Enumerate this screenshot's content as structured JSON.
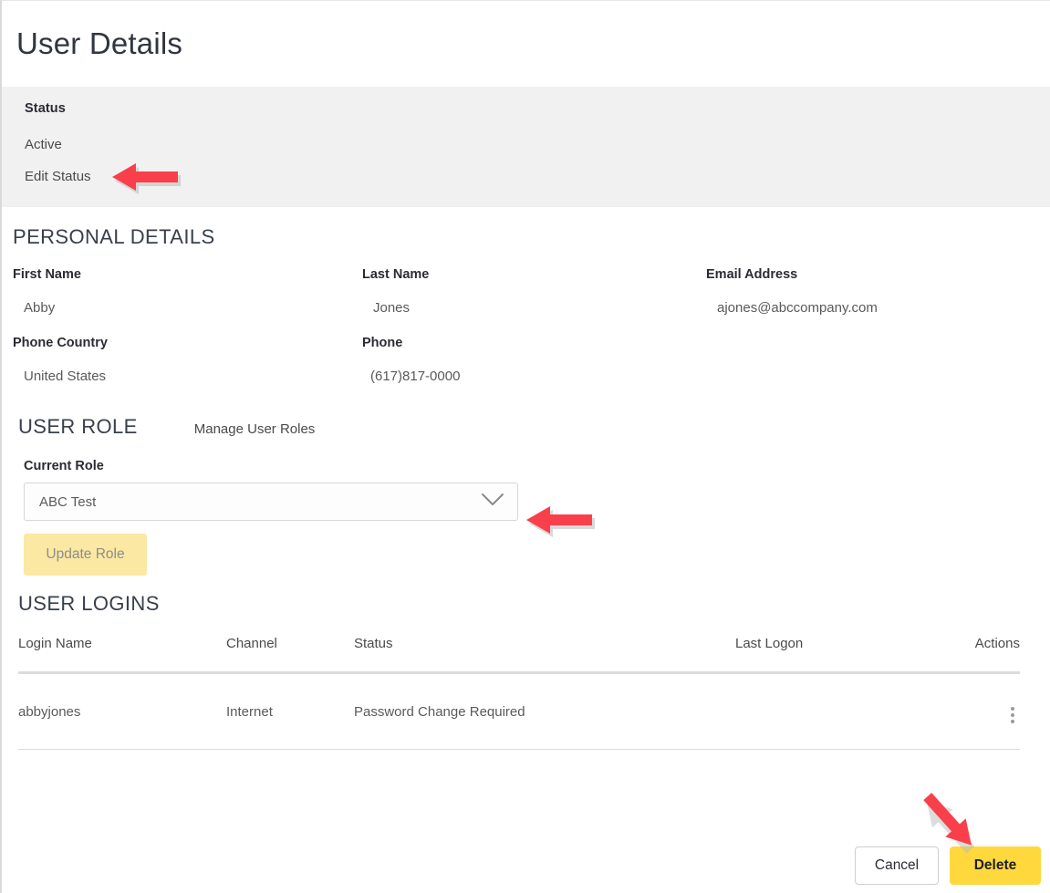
{
  "header": {
    "title": "User Details"
  },
  "status_section": {
    "label": "Status",
    "value": "Active",
    "edit_link": "Edit Status"
  },
  "personal_details": {
    "heading": "PERSONAL DETAILS",
    "fields": [
      {
        "label": "First Name",
        "value": "Abby"
      },
      {
        "label": "Last Name",
        "value": "Jones"
      },
      {
        "label": "Email Address",
        "value": "ajones@abccompany.com"
      },
      {
        "label": "Phone Country",
        "value": "United States"
      },
      {
        "label": "Phone",
        "value": "(617)817-0000"
      }
    ]
  },
  "user_role": {
    "heading": "USER ROLE",
    "manage_link": "Manage User Roles",
    "current_role_label": "Current Role",
    "selected_role": "ABC Test",
    "chevron_icon": "chevron-down-icon",
    "update_button": "Update Role"
  },
  "user_logins": {
    "heading": "USER LOGINS",
    "columns": [
      "Login Name",
      "Channel",
      "Status",
      "Last Logon",
      "Actions"
    ],
    "rows": [
      {
        "login_name": "abbyjones",
        "channel": "Internet",
        "status": "Password Change Required",
        "last_logon": "",
        "actions_icon": "kebab-menu-icon"
      }
    ]
  },
  "footer": {
    "cancel_label": "Cancel",
    "delete_label": "Delete"
  },
  "annotations": {
    "arrow_color": "#f9404a",
    "arrows": [
      "edit-status-arrow",
      "role-select-arrow",
      "delete-button-arrow"
    ]
  },
  "colors": {
    "status_band_bg": "#f1f1f1",
    "delete_yellow": "#ffd83d",
    "update_role_yellow": "#fbe8a2",
    "heading_text": "#39404a",
    "label_text": "#2b2b35",
    "value_text": "#5a5a5a",
    "divider": "#dcdcdc"
  }
}
